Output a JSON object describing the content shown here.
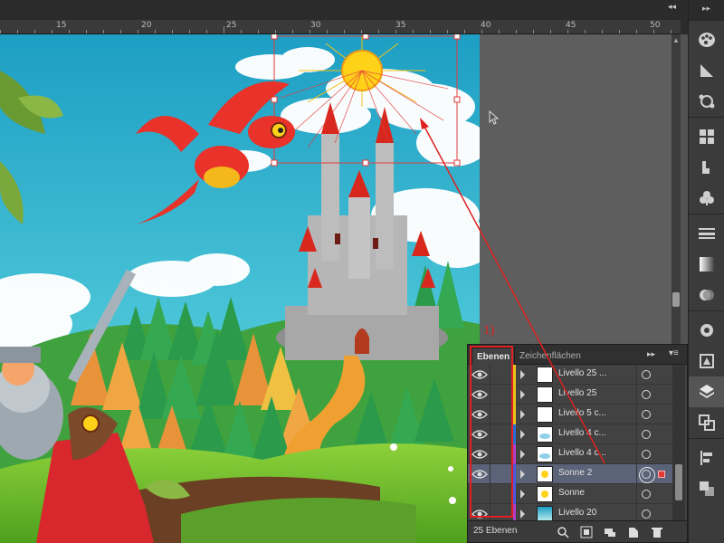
{
  "ruler": {
    "labels": [
      "15",
      "20",
      "25",
      "30",
      "35",
      "40",
      "45",
      "50"
    ],
    "collapse_icon": "double-chevron-left-icon"
  },
  "dock": {
    "collapse_icon": "double-chevron-right-icon",
    "tools": [
      "color-palette-icon",
      "color-guide-icon",
      "links-icon",
      "swatches-icon",
      "brushes-icon",
      "symbols-icon",
      "stroke-icon",
      "gradient-icon",
      "transparency-icon",
      "appearance-icon",
      "graphic-styles-icon",
      "layers-icon",
      "artboards-icon",
      "align-icon",
      "pathfinder-icon"
    ]
  },
  "layers_panel": {
    "tabs": [
      "Ebenen",
      "Zeichenflächen"
    ],
    "active_tab": "Ebenen",
    "rows": [
      {
        "name": "Livello 25 ...",
        "visible": true,
        "color": "#e8c21e",
        "selected": false
      },
      {
        "name": "Livello 25",
        "visible": true,
        "color": "#e8c21e",
        "selected": false
      },
      {
        "name": "Livello 5 c...",
        "visible": true,
        "color": "#e8c21e",
        "selected": false
      },
      {
        "name": "Livello 4 c...",
        "visible": true,
        "color": "#2a6cd6",
        "selected": false
      },
      {
        "name": "Livello 4 c...",
        "visible": true,
        "color": "#b03fc4",
        "selected": false
      },
      {
        "name": "Sonne 2",
        "visible": true,
        "color": "#4a58e0",
        "selected": true
      },
      {
        "name": "Sonne",
        "visible": false,
        "color": "#4a58e0",
        "selected": false
      },
      {
        "name": "Livello 20",
        "visible": true,
        "color": "#b03fc4",
        "selected": false
      }
    ],
    "count_label": "25 Ebenen",
    "footer_icons": [
      "locate-object-icon",
      "make-clipping-mask-icon",
      "new-sublayer-icon",
      "new-layer-icon",
      "delete-icon"
    ]
  },
  "annotation": {
    "label": "1)",
    "color": "#e02020"
  }
}
